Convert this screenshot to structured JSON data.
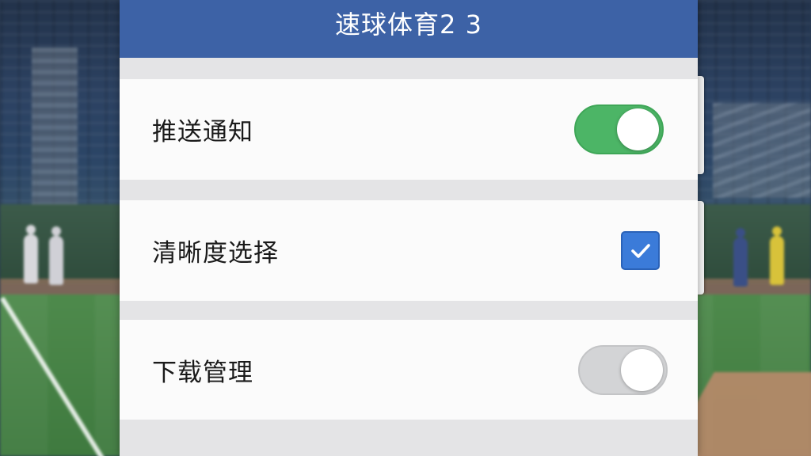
{
  "header": {
    "title": "速球体育2 3"
  },
  "settings": {
    "items": [
      {
        "label": "推送通知",
        "control": "toggle",
        "state": "on",
        "icon": "toggle-on"
      },
      {
        "label": "清晰度选择",
        "control": "checkbox",
        "state": "checked",
        "icon": "checkmark-icon"
      },
      {
        "label": "下载管理",
        "control": "toggle",
        "state": "off",
        "icon": "toggle-off"
      }
    ]
  },
  "colors": {
    "header_bg": "#3d62a6",
    "toggle_on": "#4cb566",
    "toggle_off": "#d3d4d6",
    "checkbox": "#3b7bd9",
    "row_bg": "#fbfbfb",
    "panel_bg": "#e4e4e6"
  }
}
